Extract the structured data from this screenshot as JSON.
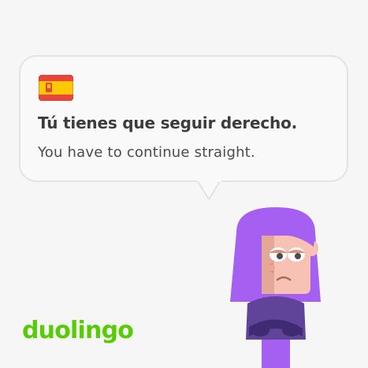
{
  "card": {
    "flag_icon": "spain-flag-icon",
    "spanish_phrase": "Tú tienes que seguir derecho.",
    "english_translation": "You have to continue straight."
  },
  "brand": {
    "logo_text": "duolingo",
    "logo_color": "#58cc02"
  },
  "character": {
    "name_icon": "lily-character-illustration"
  },
  "colors": {
    "background": "#f6f6f7",
    "bubble_border": "#e3e3e5",
    "flag_red": "#e8453c",
    "flag_yellow": "#ffc800",
    "hair_purple": "#a560f2",
    "shirt_purple": "#5f4499",
    "skin": "#f7c2b3"
  }
}
